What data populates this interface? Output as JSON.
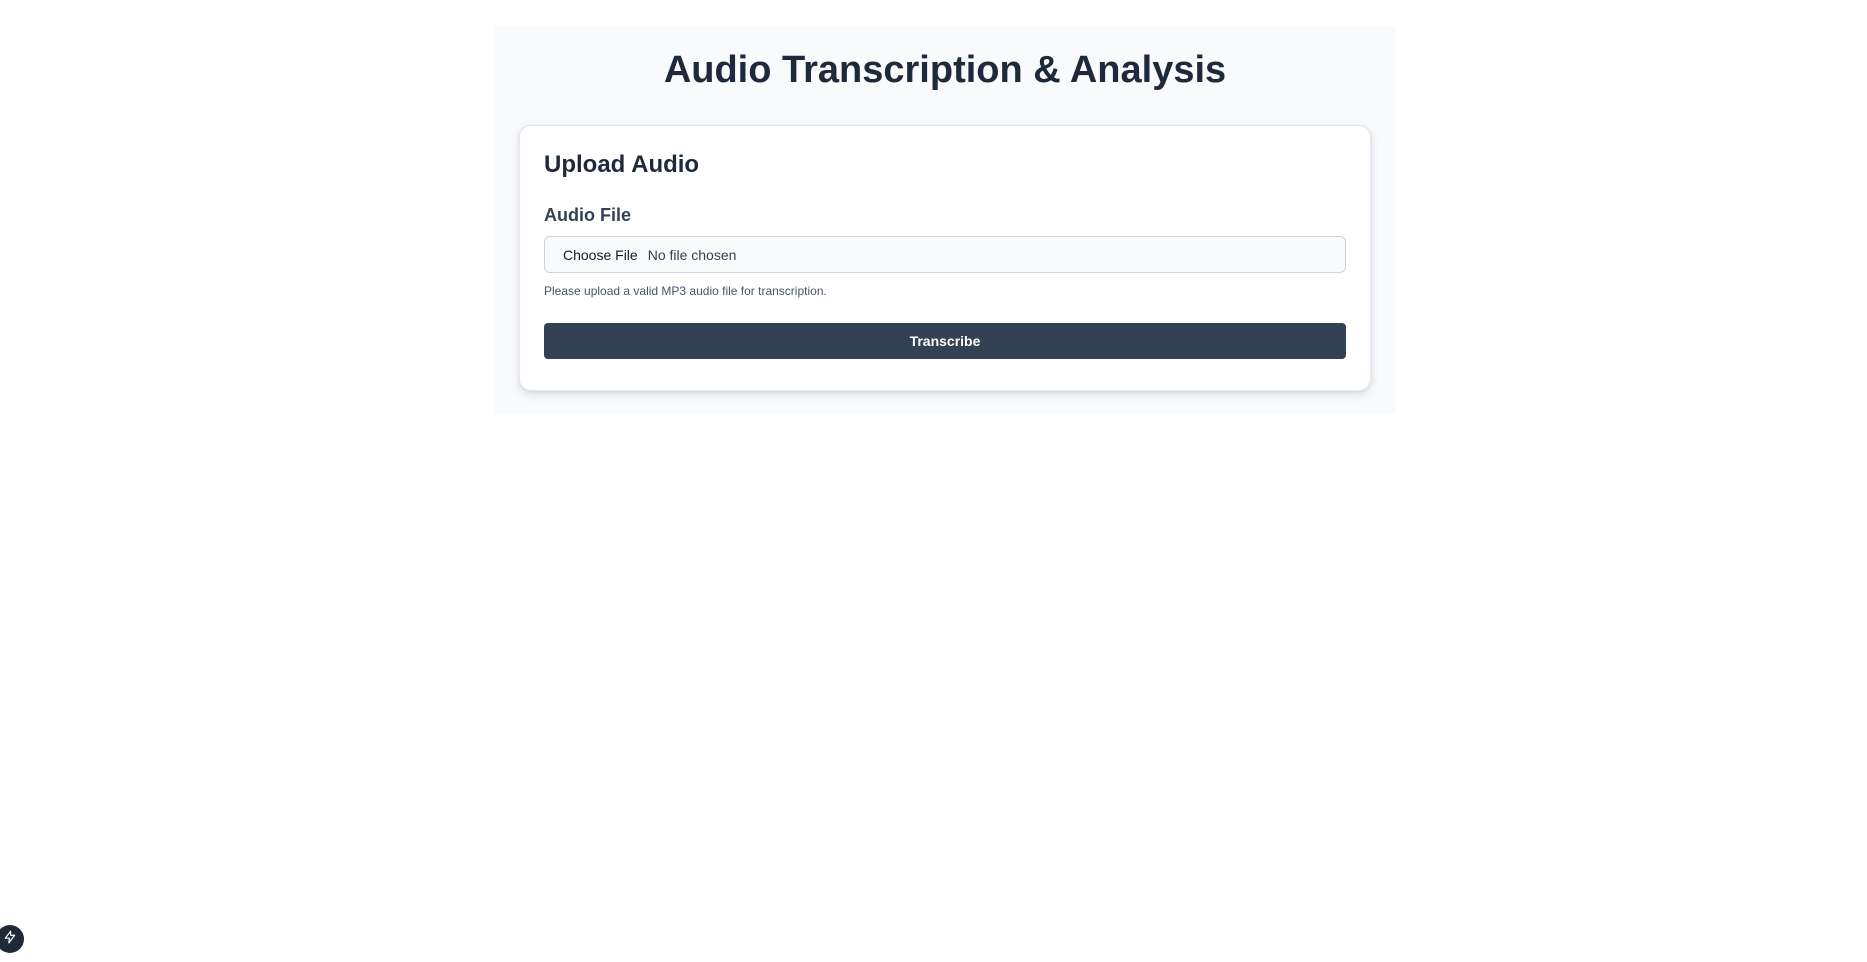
{
  "page": {
    "title": "Audio Transcription & Analysis"
  },
  "upload_card": {
    "title": "Upload Audio",
    "field_label": "Audio File",
    "choose_button_label": "Choose File",
    "file_status": "No file chosen",
    "help_text": "Please upload a valid MP3 audio file for transcription.",
    "submit_label": "Transcribe"
  },
  "corner_badge": {
    "icon": "lightning-bolt-icon"
  },
  "colors": {
    "title": "#1e293b",
    "button_bg": "#334155",
    "panel_bg": "#f8fafc",
    "badge_bg": "#1f2937"
  }
}
